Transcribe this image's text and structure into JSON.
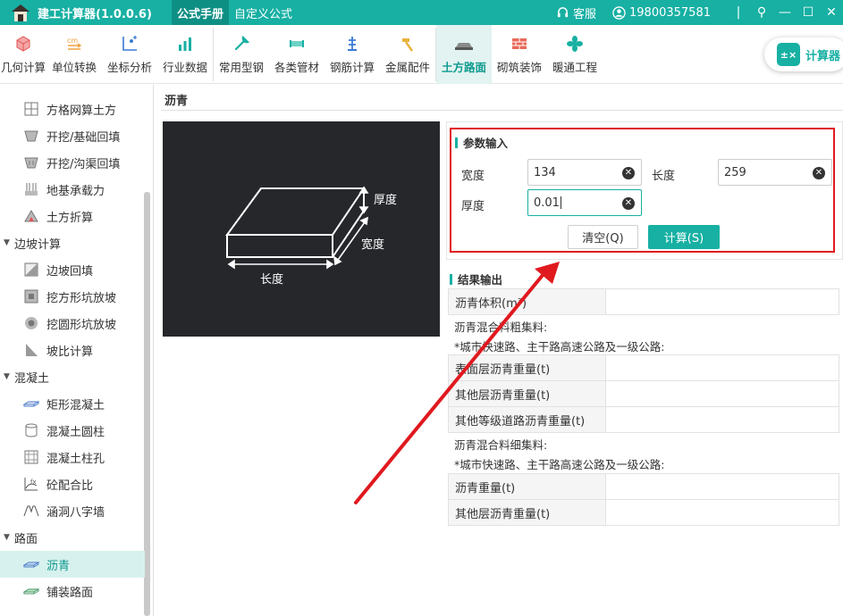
{
  "app": {
    "title": "建工计算器(1.0.0.6)"
  },
  "top_tabs": [
    {
      "label": "公式手册",
      "active": true
    },
    {
      "label": "自定义公式",
      "active": false
    }
  ],
  "titlebar_right": {
    "service": "客服",
    "user": "19800357581"
  },
  "toolbar": {
    "tools": [
      {
        "label": "几何计算",
        "icon": "cube-icon"
      },
      {
        "label": "单位转换",
        "icon": "unit-convert-icon"
      },
      {
        "label": "坐标分析",
        "icon": "coordinate-icon"
      },
      {
        "label": "行业数据",
        "icon": "bar-chart-icon"
      },
      {
        "label": "常用型钢",
        "icon": "wrench-icon"
      },
      {
        "label": "各类管材",
        "icon": "pipe-icon"
      },
      {
        "label": "钢筋计算",
        "icon": "rebar-icon"
      },
      {
        "label": "金属配件",
        "icon": "hammer-icon"
      },
      {
        "label": "土方路面",
        "icon": "road-icon",
        "active": true
      },
      {
        "label": "砌筑装饰",
        "icon": "brick-icon"
      },
      {
        "label": "暖通工程",
        "icon": "fan-icon"
      }
    ],
    "calculator_label": "计算器"
  },
  "sidebar": {
    "items": [
      {
        "type": "item",
        "label": "方格网算土方"
      },
      {
        "type": "item",
        "label": "开挖/基础回填"
      },
      {
        "type": "item",
        "label": "开挖/沟渠回填"
      },
      {
        "type": "item",
        "label": "地基承载力"
      },
      {
        "type": "item",
        "label": "土方折算"
      },
      {
        "type": "group",
        "label": "边坡计算"
      },
      {
        "type": "item",
        "label": "边坡回填"
      },
      {
        "type": "item",
        "label": "挖方形坑放坡"
      },
      {
        "type": "item",
        "label": "挖圆形坑放坡"
      },
      {
        "type": "item",
        "label": "坡比计算"
      },
      {
        "type": "group",
        "label": "混凝土"
      },
      {
        "type": "item",
        "label": "矩形混凝土"
      },
      {
        "type": "item",
        "label": "混凝土圆柱"
      },
      {
        "type": "item",
        "label": "混凝土柱孔"
      },
      {
        "type": "item",
        "label": "砼配合比"
      },
      {
        "type": "item",
        "label": "涵洞八字墙"
      },
      {
        "type": "group",
        "label": "路面"
      },
      {
        "type": "item",
        "label": "沥青",
        "active": true
      },
      {
        "type": "item",
        "label": "铺装路面"
      }
    ]
  },
  "main": {
    "title": "沥青",
    "diagram": {
      "thickness": "厚度",
      "width": "宽度",
      "length": "长度"
    },
    "params": {
      "title": "参数输入",
      "width_label": "宽度",
      "width_value": "134",
      "length_label": "长度",
      "length_value": "259",
      "thickness_label": "厚度",
      "thickness_value": "0.01",
      "clear_button": "清空(Q)",
      "calc_button": "计算(S)"
    },
    "results": {
      "title": "结果输出",
      "volume_label": "沥青体积(m³)",
      "coarse_title": "沥青混合料粗集料:",
      "coarse_note": "*城市快速路、主干路高速公路及一级公路:",
      "coarse_rows": [
        "表面层沥青重量(t)",
        "其他层沥青重量(t)",
        "其他等级道路沥青重量(t)"
      ],
      "fine_title": "沥青混合料细集料:",
      "fine_note": "*城市快速路、主干路高速公路及一级公路:",
      "fine_rows": [
        "沥青重量(t)",
        "其他层沥青重量(t)"
      ]
    }
  },
  "colors": {
    "accent": "#17b0a3",
    "highlight_border": "#e0191f"
  }
}
